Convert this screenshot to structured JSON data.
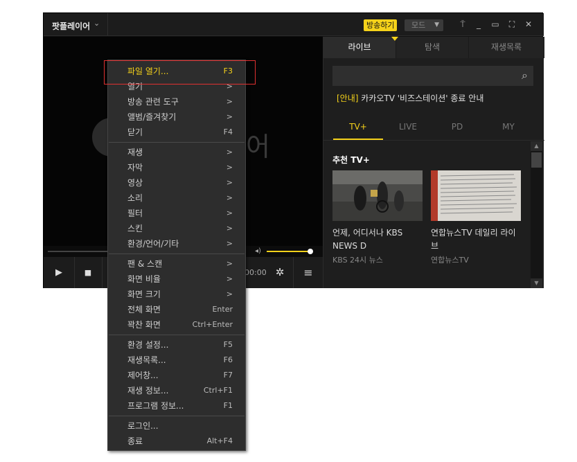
{
  "app": {
    "title": "팟플레이어",
    "title_arrow": "⌄",
    "broadcast_button": "방송하기",
    "mode_button": "모드",
    "mode_arrow": "▼",
    "pin_icon": "⍑",
    "minimize_icon": "_",
    "maximize_icon": "▭",
    "fullscreen_icon": "⛶",
    "close_icon": "✕",
    "accent_color": "#f5d21a"
  },
  "video": {
    "logo_text": "어"
  },
  "controls": {
    "play_icon": "▶",
    "stop_icon": "■",
    "time": "00:00",
    "settings_icon": "✲",
    "menu_icon": "≡",
    "volume_icon": "◂)"
  },
  "panel": {
    "tabs": [
      "라이브",
      "탐색",
      "재생목록"
    ],
    "search_icon": "⌕",
    "notice_tag": "[안내]",
    "notice_text": " 카카오TV '비즈스테이션' 종료 안내",
    "sub_tabs": [
      "TV+",
      "LIVE",
      "PD",
      "MY"
    ],
    "recommend_title": "추천 TV+",
    "cards": [
      {
        "title": "언제, 어디서나 KBS NEWS D",
        "sub": "KBS 24시 뉴스"
      },
      {
        "title": "연합뉴스TV 데일리 라이브",
        "sub": "연합뉴스TV"
      }
    ],
    "scroll_up": "▲",
    "scroll_down": "▼"
  },
  "menu": {
    "items": [
      {
        "label": "파일 열기...",
        "shortcut": "F3"
      },
      {
        "label": "열기",
        "shortcut": ">"
      },
      {
        "label": "방송 관련 도구",
        "shortcut": ">"
      },
      {
        "label": "앨범/즐겨찾기",
        "shortcut": ">"
      },
      {
        "label": "닫기",
        "shortcut": "F4"
      },
      {
        "label": "재생",
        "shortcut": ">"
      },
      {
        "label": "자막",
        "shortcut": ">"
      },
      {
        "label": "영상",
        "shortcut": ">"
      },
      {
        "label": "소리",
        "shortcut": ">"
      },
      {
        "label": "필터",
        "shortcut": ">"
      },
      {
        "label": "스킨",
        "shortcut": ">"
      },
      {
        "label": "환경/언어/기타",
        "shortcut": ">"
      },
      {
        "label": "팬 & 스캔",
        "shortcut": ">"
      },
      {
        "label": "화면 비율",
        "shortcut": ">"
      },
      {
        "label": "화면 크기",
        "shortcut": ">"
      },
      {
        "label": "전체 화면",
        "shortcut": "Enter"
      },
      {
        "label": "꽉찬 화면",
        "shortcut": "Ctrl+Enter"
      },
      {
        "label": "환경 설정...",
        "shortcut": "F5"
      },
      {
        "label": "재생목록...",
        "shortcut": "F6"
      },
      {
        "label": "제어창...",
        "shortcut": "F7"
      },
      {
        "label": "재생 정보...",
        "shortcut": "Ctrl+F1"
      },
      {
        "label": "프로그램 정보...",
        "shortcut": "F1"
      },
      {
        "label": "로그인...",
        "shortcut": ""
      },
      {
        "label": "종료",
        "shortcut": "Alt+F4"
      }
    ]
  }
}
